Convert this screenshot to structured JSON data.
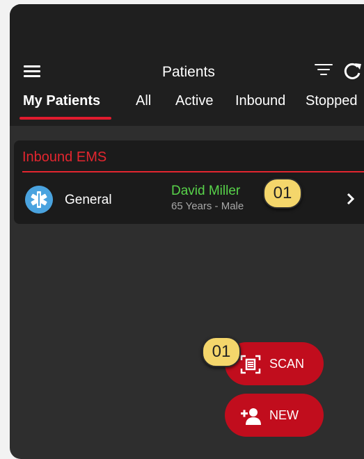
{
  "header": {
    "title": "Patients",
    "menu_icon": "hamburger-menu-icon",
    "filter_icon": "filter-icon",
    "refresh_icon": "refresh-icon"
  },
  "tabs": [
    {
      "label": "My Patients",
      "active": true
    },
    {
      "label": "All",
      "active": false
    },
    {
      "label": "Active",
      "active": false
    },
    {
      "label": "Inbound",
      "active": false
    },
    {
      "label": "Stopped",
      "active": false
    }
  ],
  "section": {
    "title": "Inbound EMS",
    "patient": {
      "category": "General",
      "category_icon": "star-of-life-icon",
      "name": "David Miller",
      "meta": "65 Years - Male",
      "badge": "01"
    }
  },
  "actions": {
    "scan": {
      "label": "SCAN",
      "icon": "scan-document-icon",
      "badge": "01"
    },
    "new": {
      "label": "NEW",
      "icon": "add-person-icon"
    }
  },
  "colors": {
    "accent_red": "#e3262f",
    "button_red": "#c10d1d",
    "name_green": "#58d34a",
    "badge_yellow": "#f4d66b"
  }
}
